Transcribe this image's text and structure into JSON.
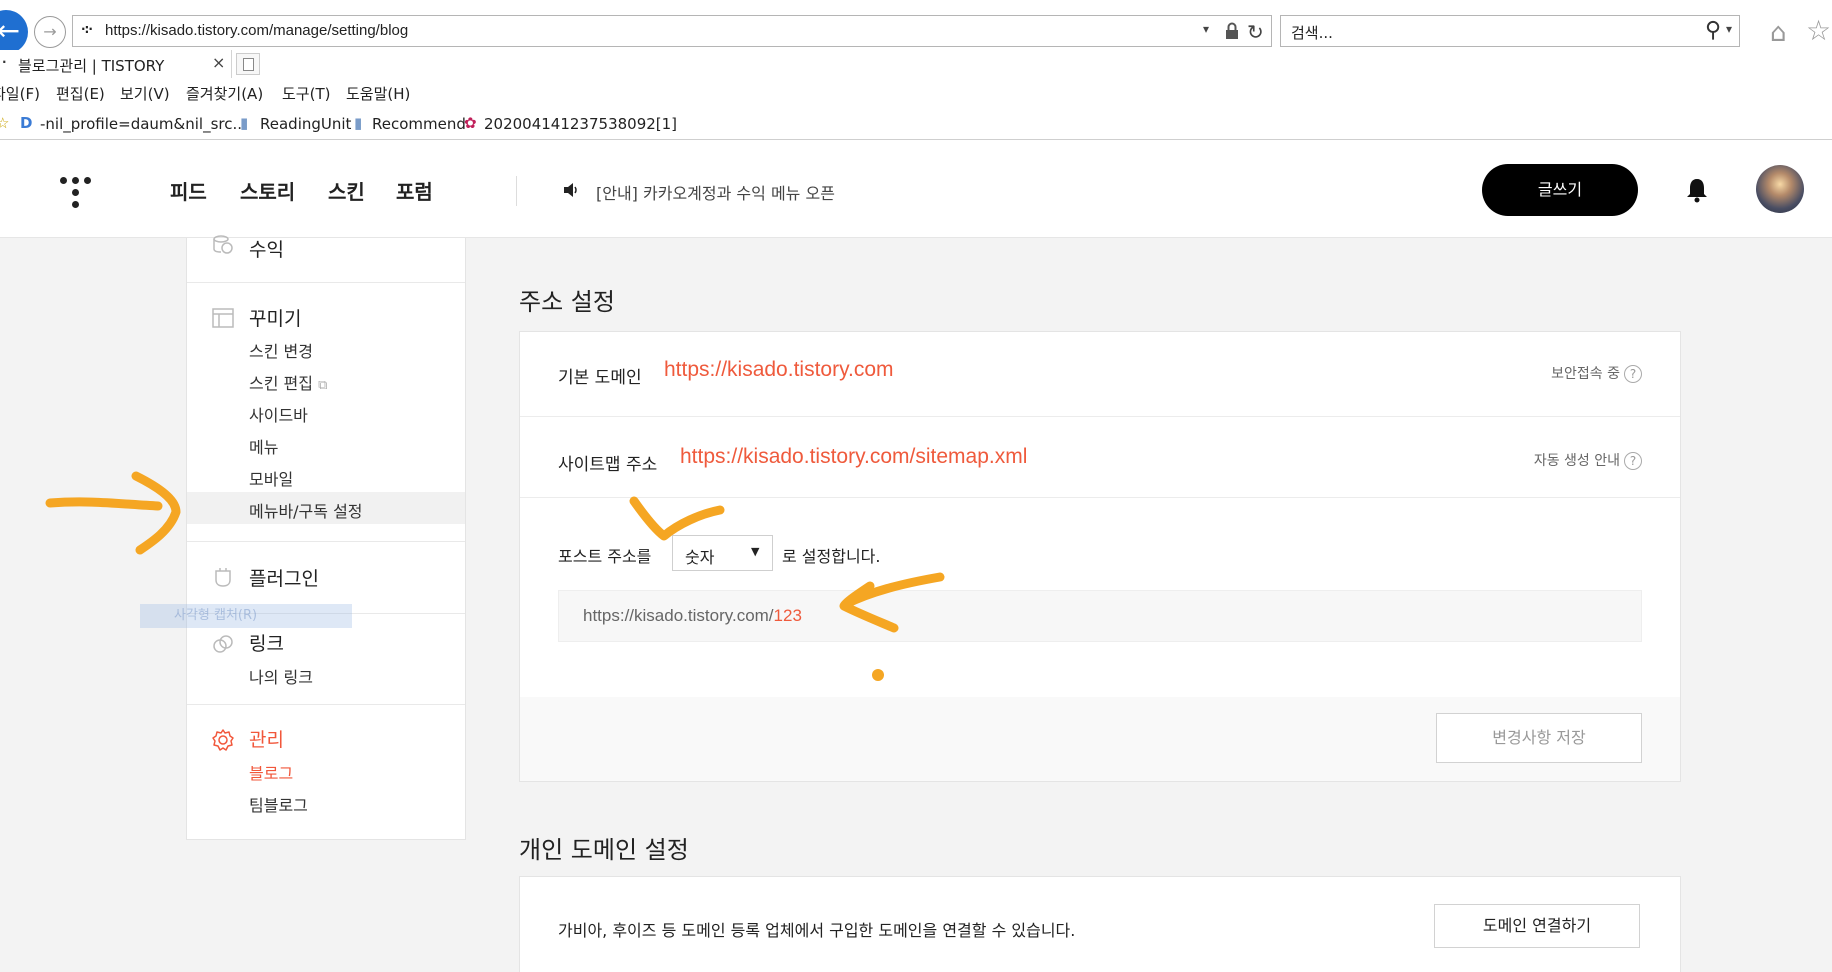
{
  "browser": {
    "url": "https://kisado.tistory.com/manage/setting/blog",
    "search_placeholder": "검색...",
    "tab_title": "블로그관리 | TISTORY",
    "tab_close": "×",
    "menu": [
      "파일(F)",
      "편집(E)",
      "보기(V)",
      "즐겨찾기(A)",
      "도구(T)",
      "도움말(H)"
    ],
    "favorites": [
      "-nil_profile=daum&nil_src...",
      "ReadingUnit",
      "Recommend",
      "202004141237538092[1]"
    ],
    "colors": {
      "back_button": "#1f6fd1"
    }
  },
  "header": {
    "nav": [
      "피드",
      "스토리",
      "스킨",
      "포럼"
    ],
    "notice": "[안내] 카카오계정과 수익 메뉴 오픈",
    "write_label": "글쓰기",
    "icons": {
      "notice": "speaker-icon",
      "bell": "bell-icon"
    }
  },
  "sidebar": {
    "revenue": "수익",
    "decorate": {
      "title": "꾸미기",
      "items": [
        "스킨 변경",
        "스킨 편집",
        "사이드바",
        "메뉴",
        "모바일",
        "메뉴바/구독 설정"
      ]
    },
    "plugin": "플러그인",
    "link": {
      "title": "링크",
      "items": [
        "나의 링크"
      ]
    },
    "manage": {
      "title": "관리",
      "items": [
        "블로그",
        "팀블로그"
      ]
    },
    "ghost_tooltip": "사각형 캡처(R)",
    "colors": {
      "active": "#f1573b"
    }
  },
  "address_settings": {
    "title": "주소 설정",
    "default_domain_label": "기본 도메인",
    "default_domain": "https://kisado.tistory.com",
    "secure_label": "보안접속 중",
    "sitemap_label": "사이트맵 주소",
    "sitemap": "https://kisado.tistory.com/sitemap.xml",
    "sitemap_help": "자동 생성 안내",
    "post_address_prefix": "포스트 주소를",
    "post_address_select": "숫자",
    "post_address_suffix": "로 설정합니다.",
    "preview_base": "https://kisado.tistory.com/",
    "preview_id": "123",
    "save_label": "변경사항 저장",
    "help_mark": "?"
  },
  "custom_domain": {
    "title": "개인 도메인 설정",
    "description": "가비아, 후이즈 등 도메인 등록 업체에서 구입한 도메인을 연결할 수 있습니다.",
    "connect_label": "도메인 연결하기"
  },
  "colors": {
    "accent": "#ef5a3c",
    "annotation": "#f5a623"
  }
}
